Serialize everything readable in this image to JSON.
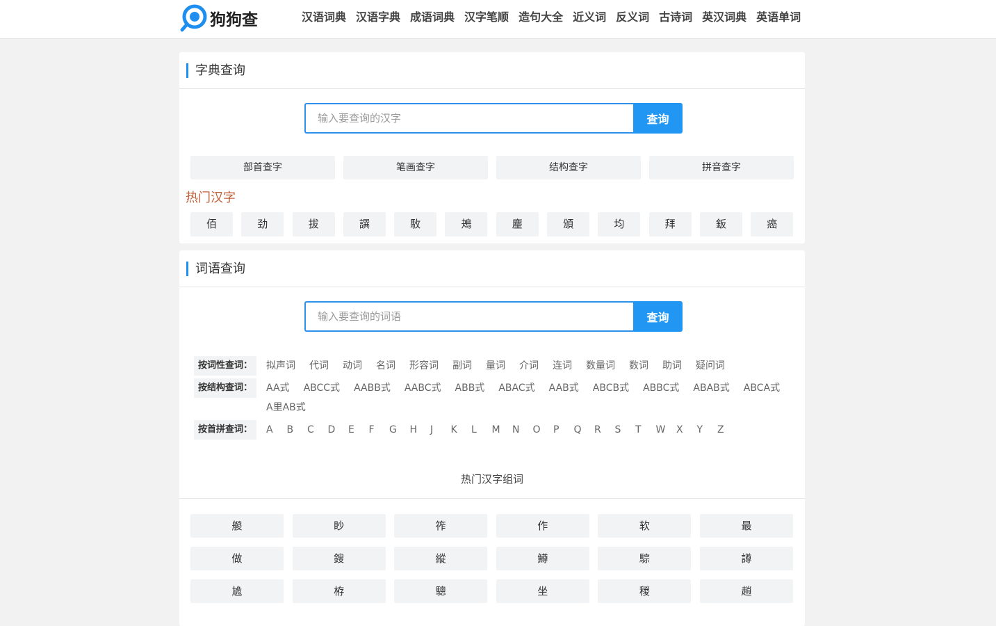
{
  "header": {
    "logo_text": "狗狗查",
    "nav": [
      "汉语词典",
      "汉语字典",
      "成语词典",
      "汉字笔顺",
      "造句大全",
      "近义词",
      "反义词",
      "古诗词",
      "英汉词典",
      "英语单词"
    ]
  },
  "dict": {
    "title": "字典查询",
    "placeholder": "输入要查询的汉字",
    "button": "查询",
    "modes": [
      "部首查字",
      "笔画查字",
      "结构查字",
      "拼音查字"
    ],
    "hot_title": "热门汉字",
    "hot_chars": [
      "佰",
      "劲",
      "拔",
      "譔",
      "駇",
      "鴂",
      "麈",
      "頒",
      "均",
      "拜",
      "鈑",
      "癌"
    ]
  },
  "words": {
    "title": "词语查询",
    "placeholder": "输入要查询的词语",
    "button": "查询",
    "pos_label": "按词性查词：",
    "pos": [
      "拟声词",
      "代词",
      "动词",
      "名词",
      "形容词",
      "副词",
      "量词",
      "介词",
      "连词",
      "数量词",
      "数词",
      "助词",
      "疑问词"
    ],
    "structure_label": "按结构查词：",
    "structure": [
      "AA式",
      "ABCC式",
      "AABB式",
      "AABC式",
      "ABB式",
      "ABAC式",
      "AAB式",
      "ABCB式",
      "ABBC式",
      "ABAB式",
      "ABCA式",
      "A里AB式"
    ],
    "initial_label": "按首拼查词：",
    "initials": [
      "A",
      "B",
      "C",
      "D",
      "E",
      "F",
      "G",
      "H",
      "J",
      "K",
      "L",
      "M",
      "N",
      "O",
      "P",
      "Q",
      "R",
      "S",
      "T",
      "W",
      "X",
      "Y",
      "Z"
    ],
    "hot_title": "热门汉字组词",
    "hot_grid": [
      "艐",
      "眇",
      "筰",
      "作",
      "软",
      "最",
      "做",
      "鎪",
      "縱",
      "鱒",
      "騌",
      "譐",
      "尯",
      "栫",
      "驄",
      "坐",
      "稯",
      "趙"
    ]
  },
  "colors": {
    "accent": "#2196f3",
    "hot_title": "#c0603a"
  }
}
